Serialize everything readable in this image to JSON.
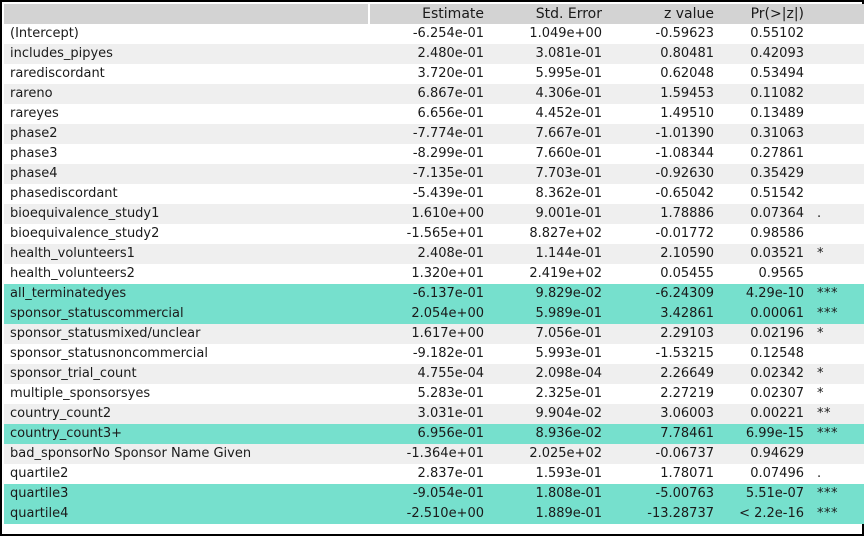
{
  "table": {
    "columns": [
      {
        "key": "term",
        "label": ""
      },
      {
        "key": "est",
        "label": "Estimate"
      },
      {
        "key": "se",
        "label": "Std. Error"
      },
      {
        "key": "z",
        "label": "z value"
      },
      {
        "key": "p",
        "label": "Pr(>|z|)"
      },
      {
        "key": "sig",
        "label": ""
      }
    ],
    "colors": {
      "header_background": "#d3d3d3",
      "row_stripe": "#efefef",
      "row_background": "#ffffff",
      "highlight": "#76e0cd",
      "border": "#000000",
      "text": "#1a1a1a"
    },
    "rows": [
      {
        "term": "(Intercept)",
        "est": "-6.254e-01",
        "se": "1.049e+00",
        "z": "-0.59623",
        "p": "0.55102",
        "sig": "",
        "highlight": false
      },
      {
        "term": "includes_pipyes",
        "est": "2.480e-01",
        "se": "3.081e-01",
        "z": "0.80481",
        "p": "0.42093",
        "sig": "",
        "highlight": false
      },
      {
        "term": "rarediscordant",
        "est": "3.720e-01",
        "se": "5.995e-01",
        "z": "0.62048",
        "p": "0.53494",
        "sig": "",
        "highlight": false
      },
      {
        "term": "rareno",
        "est": "6.867e-01",
        "se": "4.306e-01",
        "z": "1.59453",
        "p": "0.11082",
        "sig": "",
        "highlight": false
      },
      {
        "term": "rareyes",
        "est": "6.656e-01",
        "se": "4.452e-01",
        "z": "1.49510",
        "p": "0.13489",
        "sig": "",
        "highlight": false
      },
      {
        "term": "phase2",
        "est": "-7.774e-01",
        "se": "7.667e-01",
        "z": "-1.01390",
        "p": "0.31063",
        "sig": "",
        "highlight": false
      },
      {
        "term": "phase3",
        "est": "-8.299e-01",
        "se": "7.660e-01",
        "z": "-1.08344",
        "p": "0.27861",
        "sig": "",
        "highlight": false
      },
      {
        "term": "phase4",
        "est": "-7.135e-01",
        "se": "7.703e-01",
        "z": "-0.92630",
        "p": "0.35429",
        "sig": "",
        "highlight": false
      },
      {
        "term": "phasediscordant",
        "est": "-5.439e-01",
        "se": "8.362e-01",
        "z": "-0.65042",
        "p": "0.51542",
        "sig": "",
        "highlight": false
      },
      {
        "term": "bioequivalence_study1",
        "est": "1.610e+00",
        "se": "9.001e-01",
        "z": "1.78886",
        "p": "0.07364",
        "sig": ".",
        "highlight": false
      },
      {
        "term": "bioequivalence_study2",
        "est": "-1.565e+01",
        "se": "8.827e+02",
        "z": "-0.01772",
        "p": "0.98586",
        "sig": "",
        "highlight": false
      },
      {
        "term": "health_volunteers1",
        "est": "2.408e-01",
        "se": "1.144e-01",
        "z": "2.10590",
        "p": "0.03521",
        "sig": "*",
        "highlight": false
      },
      {
        "term": "health_volunteers2",
        "est": "1.320e+01",
        "se": "2.419e+02",
        "z": "0.05455",
        "p": "0.9565",
        "sig": "",
        "highlight": false
      },
      {
        "term": "all_terminatedyes",
        "est": "-6.137e-01",
        "se": "9.829e-02",
        "z": "-6.24309",
        "p": "4.29e-10",
        "sig": "***",
        "highlight": true
      },
      {
        "term": "sponsor_statuscommercial",
        "est": "2.054e+00",
        "se": "5.989e-01",
        "z": "3.42861",
        "p": "0.00061",
        "sig": "***",
        "highlight": true
      },
      {
        "term": "sponsor_statusmixed/unclear",
        "est": "1.617e+00",
        "se": "7.056e-01",
        "z": "2.29103",
        "p": "0.02196",
        "sig": "*",
        "highlight": false
      },
      {
        "term": "sponsor_statusnoncommercial",
        "est": "-9.182e-01",
        "se": "5.993e-01",
        "z": "-1.53215",
        "p": "0.12548",
        "sig": "",
        "highlight": false
      },
      {
        "term": "sponsor_trial_count",
        "est": "4.755e-04",
        "se": "2.098e-04",
        "z": "2.26649",
        "p": "0.02342",
        "sig": "*",
        "highlight": false
      },
      {
        "term": "multiple_sponsorsyes",
        "est": "5.283e-01",
        "se": "2.325e-01",
        "z": "2.27219",
        "p": "0.02307",
        "sig": "*",
        "highlight": false
      },
      {
        "term": "country_count2",
        "est": "3.031e-01",
        "se": "9.904e-02",
        "z": "3.06003",
        "p": "0.00221",
        "sig": "**",
        "highlight": false
      },
      {
        "term": "country_count3+",
        "est": "6.956e-01",
        "se": "8.936e-02",
        "z": "7.78461",
        "p": "6.99e-15",
        "sig": "***",
        "highlight": true
      },
      {
        "term": "bad_sponsorNo Sponsor Name Given",
        "est": "-1.364e+01",
        "se": "2.025e+02",
        "z": "-0.06737",
        "p": "0.94629",
        "sig": "",
        "highlight": false
      },
      {
        "term": "quartile2",
        "est": "2.837e-01",
        "se": "1.593e-01",
        "z": "1.78071",
        "p": "0.07496",
        "sig": ".",
        "highlight": false
      },
      {
        "term": "quartile3",
        "est": "-9.054e-01",
        "se": "1.808e-01",
        "z": "-5.00763",
        "p": "5.51e-07",
        "sig": "***",
        "highlight": true
      },
      {
        "term": "quartile4",
        "est": "-2.510e+00",
        "se": "1.889e-01",
        "z": "-13.28737",
        "p": "< 2.2e-16",
        "sig": "***",
        "highlight": true
      }
    ]
  }
}
